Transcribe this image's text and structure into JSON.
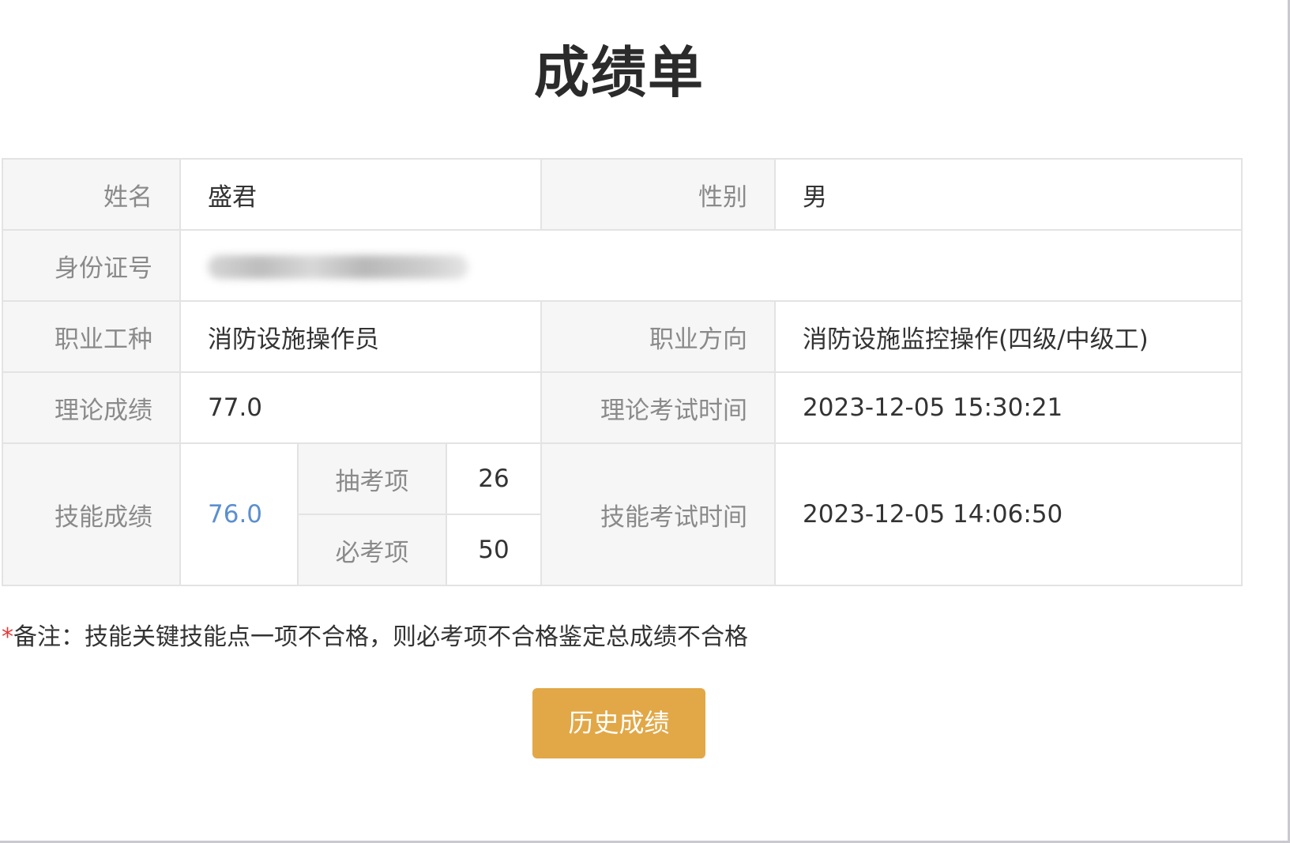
{
  "page": {
    "title": "成绩单"
  },
  "table": {
    "name_label": "姓名",
    "name_value": "盛君",
    "gender_label": "性别",
    "gender_value": "男",
    "id_label": "身份证号",
    "occupation_label": "职业工种",
    "occupation_value": "消防设施操作员",
    "direction_label": "职业方向",
    "direction_value": "消防设施监控操作(四级/中级工)",
    "theory_score_label": "理论成绩",
    "theory_score_value": "77.0",
    "theory_time_label": "理论考试时间",
    "theory_time_value": "2023-12-05 15:30:21",
    "skill_score_label": "技能成绩",
    "skill_score_value": "76.0",
    "random_item_label": "抽考项",
    "random_item_value": "26",
    "required_item_label": "必考项",
    "required_item_value": "50",
    "skill_time_label": "技能考试时间",
    "skill_time_value": "2023-12-05 14:06:50"
  },
  "note": {
    "marker": "*",
    "text": "备注：技能关键技能点一项不合格，则必考项不合格鉴定总成绩不合格"
  },
  "actions": {
    "history_button_label": "历史成绩"
  },
  "colors": {
    "accent_button": "#e2a847",
    "skill_score_text": "#5b8fd0",
    "note_marker": "#e23c3c",
    "label_background": "#f6f6f6",
    "border": "#e3e3e3"
  },
  "icons": {
    "blurred_id": "redacted-blur"
  }
}
